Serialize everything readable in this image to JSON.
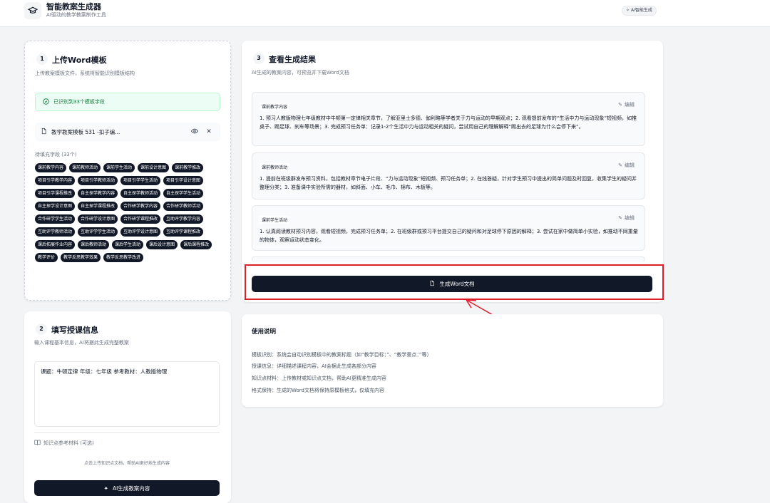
{
  "header": {
    "title": "智能教案生成器",
    "subtitle": "AI驱动的教学教案制作工具",
    "badge": "AI智能生成"
  },
  "upload_card": {
    "step": "1",
    "title": "上传Word模板",
    "desc": "上传教案模板文件，系统将智能识别模板结构",
    "success": "已识别到33个模板字段",
    "file_name": "教学教案模板 531 -扣子编...",
    "fields_label": "待填充字段 (33个)",
    "tags": [
      "课前教学内容",
      "课前教师活动",
      "课前学生活动",
      "课前设计意图",
      "课前教学推改",
      "项目引学教学内容",
      "项目引学教师活动",
      "项目引学学生活动",
      "项目引学设计意图",
      "项目引学课程推改",
      "自主探学教学内容",
      "自主探学教师活动",
      "自主探学学生活动",
      "自主探学设计意图",
      "自主探学课程推改",
      "合作研学教学内容",
      "合作研学教师活动",
      "合作研学学生活动",
      "合作研学设计意图",
      "合作研学课程推改",
      "互助评学教学内容",
      "互助评学教师活动",
      "互助评学学生活动",
      "互助评学设计意图",
      "互助评学课程推改",
      "课后拓展作业内容",
      "课后教师活动",
      "课后学生活动",
      "课后设计意图",
      "课后课程推改",
      "教学评价",
      "教学反思教学效果",
      "教学反思教学改进"
    ]
  },
  "info_card": {
    "step": "2",
    "title": "填写授课信息",
    "desc": "输入课程基本信息，AI将据此生成完整教案",
    "textarea_value": "课题：牛顿定律  年级：七年级   参考教材：人教版物理",
    "kb_label": "知识点参考材料 (可选)",
    "kb_hint": "点击上传知识点文档，帮助AI更好地生成内容",
    "button": "AI生成教案内容"
  },
  "result_card": {
    "step": "3",
    "title": "查看生成结果",
    "desc": "AI生成的教案内容，可预览并下载Word文档",
    "edit_label": "编辑",
    "items": [
      {
        "label": "课前教学内容",
        "text": "1. 预习人教版物理七年级教材中牛顿第一定律相关章节，了解亚里士多德、伽利略等学者关于力与运动的早期观点；2. 观看提前发布的“生活中力与运动现象”短视频，如推桌子、踢足球、刹车等场景；3. 完成预习任务单：记录1-2个生活中力与运动相关的疑问，尝试用自己的理解解释“踢出去的足球为什么会停下来”。"
      },
      {
        "label": "课前教师活动",
        "text": "1. 提前在班级群发布预习资料，包括教材章节电子片段、“力与运动现象”短视频、预习任务单；2. 在线答疑，针对学生预习中提出的简单问题及时回复，收集学生的疑问并整理分类；3. 准备课中实验所需的器材，如斜面、小车、毛巾、棉布、木板等。"
      },
      {
        "label": "课前学生活动",
        "text": "1. 认真阅读教材预习内容，观看短视频，完成预习任务单；2. 在班级群或预习平台提交自己的疑问和对足球停下原因的解释；3. 尝试在家中做简单小实验，如推动不同重量的物体，观察运动状态变化。"
      }
    ],
    "generate_button": "生成Word文档"
  },
  "instructions": {
    "title": "使用说明",
    "items": [
      "模板识别：系统会自动识别模板中的教案标题（如“教学目标：”、“教学重点：”等）",
      "授课信息：详细描述课程内容，AI会据此生成各部分内容",
      "知识点材料：上传教材或知识点文档，帮助AI更精准生成内容",
      "格式保持：生成的Word文档将保持原模板格式，仅填充内容"
    ]
  },
  "colors": {
    "accent": "#111827",
    "highlight": "#e11d2a",
    "success": "#15803d"
  }
}
